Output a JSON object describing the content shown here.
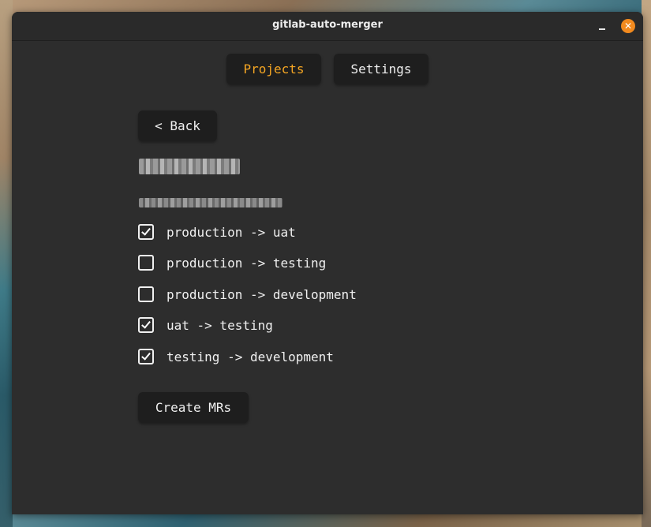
{
  "window": {
    "title": "gitlab-auto-merger",
    "minimize_icon": "minimize-icon",
    "close_icon": "close-icon",
    "close_glyph": "✕",
    "accent_color": "#f5a623",
    "close_color": "#f28a1e"
  },
  "tabs": [
    {
      "label": "Projects",
      "active": true
    },
    {
      "label": "Settings",
      "active": false
    }
  ],
  "back_button": {
    "label": "< Back"
  },
  "project": {
    "name": "",
    "path": ""
  },
  "branches": [
    {
      "label": "production -> uat",
      "checked": true
    },
    {
      "label": "production -> testing",
      "checked": false
    },
    {
      "label": "production -> development",
      "checked": false
    },
    {
      "label": "uat -> testing",
      "checked": true
    },
    {
      "label": "testing -> development",
      "checked": true
    }
  ],
  "create_button": {
    "label": "Create MRs"
  }
}
